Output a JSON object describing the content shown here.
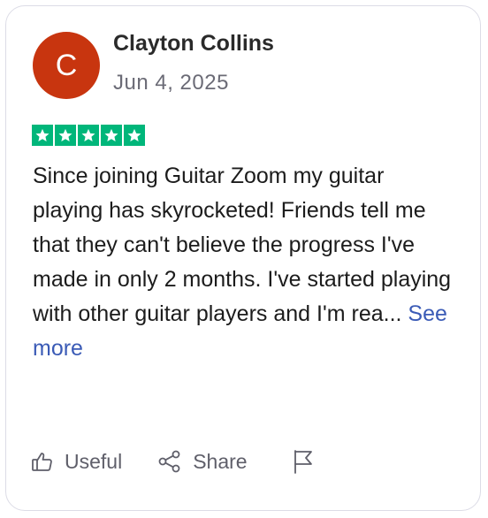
{
  "review": {
    "avatar_initial": "C",
    "avatar_color": "#c8350f",
    "reviewer_name": "Clayton Collins",
    "date": "Jun 4, 2025",
    "rating": 5,
    "rating_max": 5,
    "star_color": "#00b67a",
    "text": "Since joining Guitar Zoom my guitar playing has skyrocketed! Friends tell me that they can't believe the progress I've made in only 2 months. I've started playing with other guitar players and I'm rea...",
    "see_more_label": "See more"
  },
  "actions": {
    "useful_label": "Useful",
    "useful_icon": "thumbs-up-icon",
    "share_label": "Share",
    "share_icon": "share-icon",
    "report_icon": "flag-icon"
  }
}
